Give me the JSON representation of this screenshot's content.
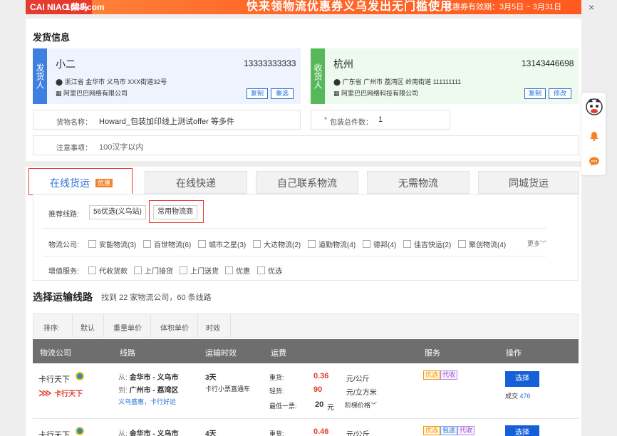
{
  "banner": {
    "logo_left": "CAI NIAO 菜鸟",
    "logo_right": "1688.com",
    "headline": "快来领物流优惠券义乌发出无门槛使用",
    "period": "优惠券有效期：3月5日 ~ 3月31日",
    "close": "×"
  },
  "shipping": {
    "title": "发货信息",
    "sender": {
      "side": "发货人",
      "name": "小二",
      "phone": "13333333333",
      "address": "浙江省 金华市 义乌市 XXX街道32号",
      "company": "阿里巴巴网络有限公司",
      "copy": "复制",
      "reselect": "重选"
    },
    "receiver": {
      "side": "收货人",
      "name": "杭州",
      "phone": "13143446698",
      "address": "广东省 广州市 荔湾区 岭南街道 111111111",
      "company": "阿里巴巴网络科技有限公司",
      "copy": "复制",
      "modify": "修改"
    },
    "goods_label": "货物名称：",
    "goods_value": "Howard_包装加印线上测试offer 等多件",
    "count_star": "*",
    "count_label": "包装总件数：",
    "count_value": "1",
    "note_label": "注意事项：",
    "note_placeholder": "100汉字以内"
  },
  "tabs": [
    {
      "label": "在线货运",
      "badge": "优惠"
    },
    {
      "label": "在线快递"
    },
    {
      "label": "自己联系物流"
    },
    {
      "label": "无需物流"
    },
    {
      "label": "同城货运"
    }
  ],
  "filters": {
    "route_label": "推荐线路:",
    "route_chip": "56优选(义乌站)",
    "common_chip": "常用物流商",
    "company_label": "物流公司:",
    "companies": [
      "安能物流(3)",
      "百世物流(6)",
      "城市之星(3)",
      "大达物流(2)",
      "道勤物流(4)",
      "德邦(4)",
      "佳吉快运(2)",
      "聚创物流(4)"
    ],
    "more": "更多",
    "service_label": "增值服务:",
    "services": [
      "代收货款",
      "上门接货",
      "上门送货",
      "优惠",
      "优选"
    ]
  },
  "routes": {
    "title": "选择运输线路",
    "summary": "找到 22 家物流公司，60 条线路",
    "sort_label": "排序:",
    "sort_options": [
      "默认",
      "重量单价",
      "体积单价",
      "时效"
    ],
    "headers": [
      "物流公司",
      "线路",
      "运输时效",
      "运费",
      "服务",
      "操作"
    ],
    "rows": [
      {
        "company": "卡行天下",
        "brand": "卡行天下",
        "from_label": "从:",
        "from": "金华市 - 义乌市",
        "to_label": "到:",
        "to": "广州市 - 荔湾区",
        "stations": "义乌盛惠，卡行好运",
        "days": "3天",
        "mode": "卡行小票直通车",
        "heavy_label": "重货:",
        "heavy_price": "0.36",
        "heavy_unit": "元/公斤",
        "light_label": "轻货:",
        "light_price": "90",
        "light_unit": "元/立方米",
        "min_label": "最低一票:",
        "min_price": "20",
        "min_unit": "元",
        "tier": "阶梯价格",
        "tags": [
          "优选",
          "代收"
        ],
        "select": "选择",
        "deals_label": "成交",
        "deals": "476"
      },
      {
        "company": "卡行天下",
        "from_label": "从:",
        "from": "金华市 - 义乌市",
        "days": "4天",
        "heavy_label": "重货:",
        "heavy_price": "0.46",
        "heavy_unit": "元/公斤",
        "tags": [
          "优选",
          "包送",
          "代收"
        ],
        "select": "选择"
      }
    ]
  },
  "side_tools": [
    "mascot-icon",
    "bell-icon",
    "chat-icon"
  ]
}
